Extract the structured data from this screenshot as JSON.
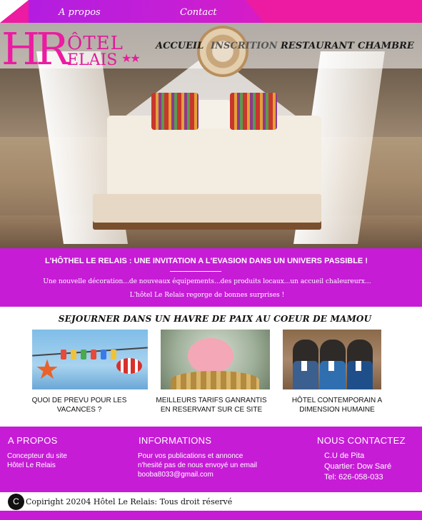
{
  "topbar": {
    "about_link": "A propos",
    "contact_link": "Contact"
  },
  "logo": {
    "initials": "HR",
    "word1": "ÔTEL",
    "word2": "ELAIS",
    "stars": "★★"
  },
  "nav": {
    "items": [
      "ACCUEIL",
      "INSCRITION",
      "RESTAURANT",
      "CHAMBRE"
    ]
  },
  "banner": {
    "title": "L'HÔTHEL LE RELAIS : UNE INVITATION A L'EVASION DANS UN UNIVERS PASSIBLE !",
    "line1": "Une nouvelle décoration...de nouveaux équipements...des produits locaux...un accueil chaleureurx...",
    "line2": "L'hôtel Le Relais regorge de bonnes surprises !"
  },
  "section": {
    "title": "SEJOURNER DANS UN HAVRE DE PAIX AU COEUR DE MAMOU",
    "cards": [
      {
        "caption": "QUOI DE PREVU POUR LES VACANCES ?",
        "image": "summertime-clothesline-image"
      },
      {
        "caption": "MEILLEURS TARIFS GANRANTIS EN RESERVANT SUR CE SITE",
        "image": "piggy-bank-coins-image"
      },
      {
        "caption": "HÔTEL CONTEMPORAIN A DIMENSION HUMAINE",
        "image": "hotel-staff-image"
      }
    ]
  },
  "footer": {
    "about": {
      "heading": "A PROPOS",
      "line1": "Concepteur du site",
      "line2": "Hôtel Le Relais"
    },
    "info": {
      "heading": "INFORMATIONS",
      "line1": "Pour vos publications et annonce",
      "line2": "n'hesité pas de nous envoyé un email",
      "line3": "booba8033@gmail.com"
    },
    "contact": {
      "heading": "NOUS CONTACTEZ",
      "line1": "C.U de Pita",
      "line2": "Quartier: Dow Saré",
      "line3": "Tel: 626-058-033"
    }
  },
  "copyright": {
    "symbol": "C",
    "text": "Copiright 20204 Hôtel Le Relais: Tous droit réservé"
  },
  "colors": {
    "magenta": "#ec1ba2",
    "purple": "#c61cd6",
    "white": "#ffffff"
  }
}
